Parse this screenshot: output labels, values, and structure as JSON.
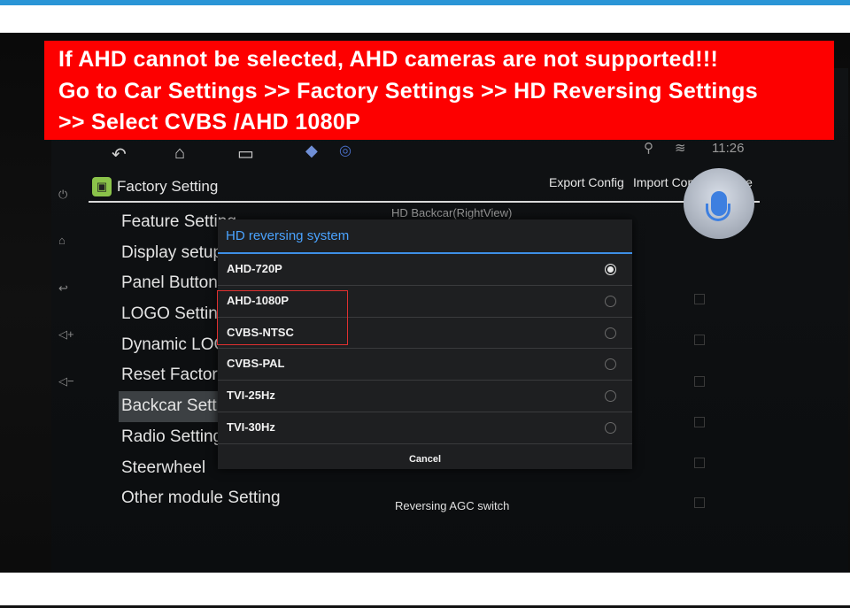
{
  "banner": {
    "line1": "If AHD cannot be selected, AHD cameras are not supported!!!",
    "line2": "Go to Car Settings >> Factory Settings >> HD Reversing Settings",
    "line3": ">> Select CVBS /AHD 1080P"
  },
  "status_bar": {
    "time": "11:26"
  },
  "header": {
    "title": "Factory Setting",
    "export_label": "Export Config",
    "import_label": "Import Config",
    "save_label": "Save"
  },
  "menu": {
    "items": [
      "Feature Setting",
      "Display setup",
      "Panel Button",
      "LOGO Setting",
      "Dynamic LOGO",
      "Reset Factory",
      "Backcar Setting",
      "Radio Setting",
      "Steerwheel",
      "Other module Setting"
    ]
  },
  "background_settings": {
    "top_label": "HD Backcar(RightView)",
    "agc_label": "Reversing AGC switch"
  },
  "dialog": {
    "title": "HD reversing system",
    "options": [
      {
        "label": "AHD-720P",
        "selected": true
      },
      {
        "label": "AHD-1080P",
        "selected": false
      },
      {
        "label": "CVBS-NTSC",
        "selected": false
      },
      {
        "label": "CVBS-PAL",
        "selected": false
      },
      {
        "label": "TVI-25Hz",
        "selected": false
      },
      {
        "label": "TVI-30Hz",
        "selected": false
      }
    ],
    "cancel_label": "Cancel"
  },
  "colors": {
    "banner_red": "#fd0000",
    "accent_blue": "#4aa3ff",
    "highlight_red": "#e03030",
    "top_bar_blue": "#2a95d6"
  }
}
